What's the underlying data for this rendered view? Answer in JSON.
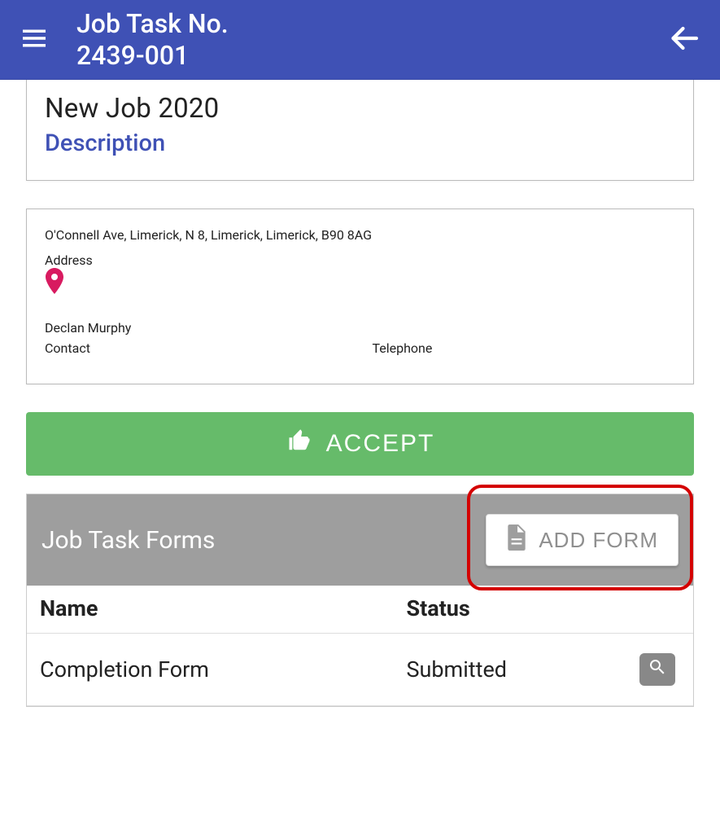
{
  "header": {
    "title_line1": "Job Task No.",
    "title_line2": "2439-001"
  },
  "job": {
    "title": "New Job 2020",
    "description_label": "Description"
  },
  "location": {
    "address": "O'Connell Ave, Limerick, N 8, Limerick, Limerick, B90 8AG",
    "address_label": "Address",
    "contact_name": "Declan Murphy",
    "contact_label": "Contact",
    "telephone_label": "Telephone"
  },
  "actions": {
    "accept_label": "ACCEPT"
  },
  "forms_section": {
    "title": "Job Task Forms",
    "add_label": "ADD FORM",
    "columns": {
      "name": "Name",
      "status": "Status"
    },
    "rows": [
      {
        "name": "Completion Form",
        "status": "Submitted"
      }
    ]
  }
}
